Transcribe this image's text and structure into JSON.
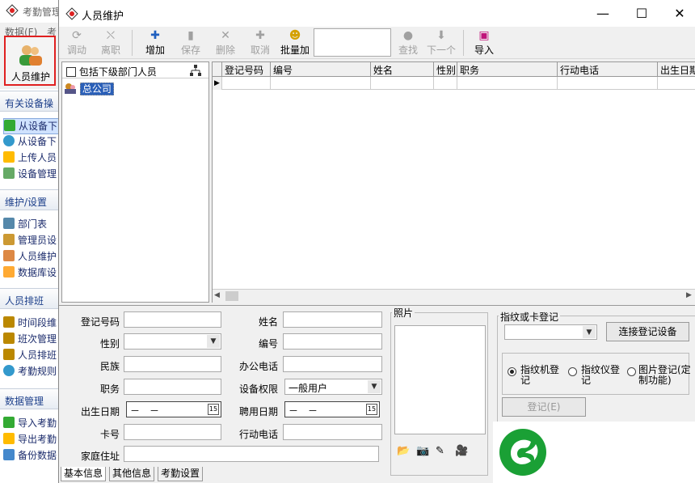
{
  "bg_app": {
    "title": "考勤管理",
    "menu": [
      "数据(F)",
      "考"
    ],
    "big_button_label": "人员维护",
    "sections": [
      {
        "title": "有关设备操",
        "items": [
          "从设备下",
          "从设备下",
          "上传人员",
          "设备管理"
        ]
      },
      {
        "title": "维护/设置",
        "items": [
          "部门表",
          "管理员设",
          "人员维护",
          "数据库设"
        ]
      },
      {
        "title": "人员排班",
        "items": [
          "时间段维",
          "班次管理",
          "人员排班",
          "考勤规则"
        ]
      },
      {
        "title": "数据管理",
        "items": [
          "导入考勤",
          "导出考勤",
          "备份数据"
        ]
      }
    ]
  },
  "dialog": {
    "title": "人员维护",
    "window_buttons": {
      "minimize": "—",
      "maximize": "☐",
      "close": "✕"
    },
    "toolbar": [
      {
        "label": "调动",
        "glyph": "⟳",
        "disabled": true
      },
      {
        "label": "离职",
        "glyph": "⛌",
        "disabled": true
      },
      {
        "label": "增加",
        "glyph": "✚",
        "disabled": false
      },
      {
        "label": "保存",
        "glyph": "▮",
        "disabled": true
      },
      {
        "label": "删除",
        "glyph": "✕",
        "disabled": true
      },
      {
        "label": "取消",
        "glyph": "✚",
        "disabled": true
      },
      {
        "label": "批量加",
        "glyph": "☻",
        "disabled": false
      },
      {
        "label": "查找",
        "glyph": "●",
        "disabled": true
      },
      {
        "label": "下一个",
        "glyph": "⬇",
        "disabled": true
      },
      {
        "label": "导入",
        "glyph": "▣",
        "disabled": false
      }
    ],
    "search_value": "",
    "tree": {
      "include_sub_label": "包括下级部门人员",
      "root": "总公司"
    },
    "grid": {
      "columns": [
        "登记号码",
        "编号",
        "姓名",
        "性别",
        "职务",
        "行动电话",
        "出生日期"
      ]
    },
    "form": {
      "labels": {
        "reg_no": "登记号码",
        "gender": "性别",
        "ethnicity": "民族",
        "position": "职务",
        "birth": "出生日期",
        "card": "卡号",
        "address": "家庭住址",
        "name": "姓名",
        "number": "编号",
        "office_phone": "办公电话",
        "permission": "设备权限",
        "hire_date": "聘用日期",
        "mobile": "行动电话"
      },
      "values": {
        "reg_no": "",
        "gender": "",
        "ethnicity": "",
        "position": "",
        "birth": "－　－",
        "card": "",
        "address": "",
        "name": "",
        "number": "",
        "office_phone": "",
        "permission": "一般用户",
        "hire_date": "－　－",
        "mobile": ""
      },
      "photo_label": "照片",
      "photo_tools": [
        "📂",
        "📷",
        "✎",
        "🎥"
      ],
      "fp_group_label": "指纹或卡登记",
      "fp_select_value": "",
      "connect_button": "连接登记设备",
      "radios": [
        {
          "label": "指纹机登记",
          "checked": true
        },
        {
          "label": "指纹仪登记",
          "checked": false
        },
        {
          "label": "图片登记(定制功能)",
          "checked": false
        }
      ],
      "register_button": "登记(E)",
      "tabs": [
        "基本信息",
        "其他信息",
        "考勤设置"
      ]
    }
  }
}
